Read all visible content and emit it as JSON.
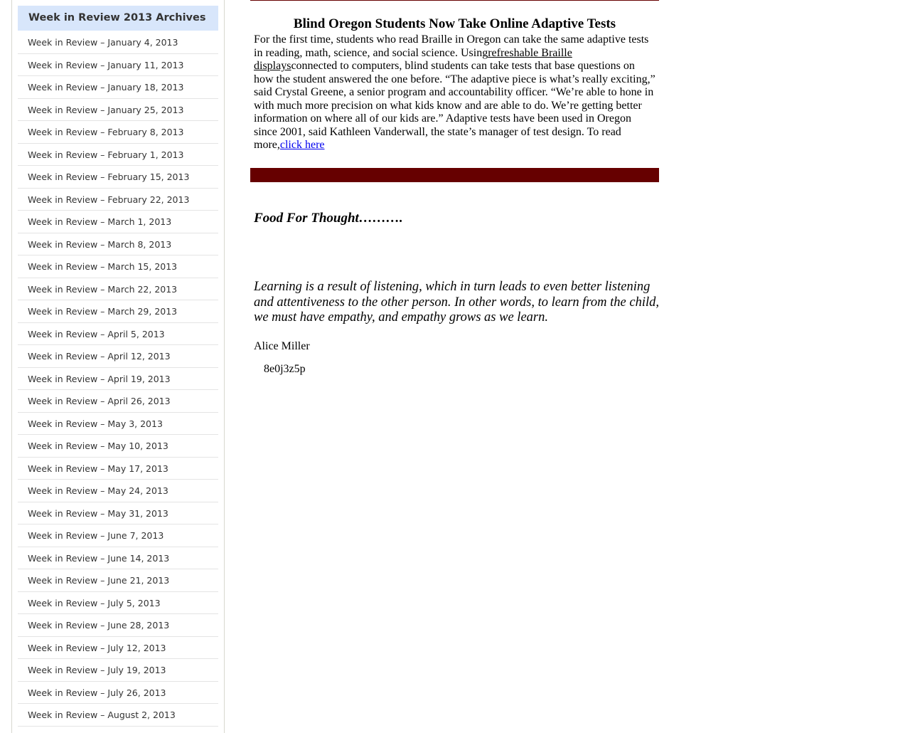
{
  "sidebar": {
    "title": "Week in Review 2013 Archives",
    "items": [
      "Week in Review – January 4, 2013",
      "Week in Review – January 11, 2013",
      "Week in Review – January 18, 2013",
      "Week in Review – January 25, 2013",
      "Week in Review – February 8, 2013",
      "Week in Review – February 1, 2013",
      "Week in Review – February 15, 2013",
      "Week in Review – February 22, 2013",
      "Week in Review – March 1, 2013",
      "Week in Review – March 8, 2013",
      "Week in Review – March 15, 2013",
      "Week in Review – March 22, 2013",
      "Week in Review – March 29, 2013",
      "Week in Review – April 5, 2013",
      "Week in Review – April 12, 2013",
      "Week in Review – April 19, 2013",
      "Week in Review – April 26, 2013",
      "Week in Review – May 3, 2013",
      "Week in Review – May 10, 2013",
      "Week in Review – May 17, 2013",
      "Week in Review – May 24, 2013",
      "Week in Review – May 31, 2013",
      "Week in Review – June 7, 2013",
      "Week in Review – June 14, 2013",
      "Week in Review – June 21, 2013",
      "Week in Review – July 5, 2013",
      "Week in Review – June 28, 2013",
      "Week in Review – July 12, 2013",
      "Week in Review – July 19, 2013",
      "Week in Review – July 26, 2013",
      "Week in Review – August 2, 2013"
    ]
  },
  "article": {
    "title": "Blind Oregon Students Now Take Online Adaptive Tests",
    "text1": "For the first time, students who read Braille in Oregon can take the same adaptive tests in reading, math, science, and social science. Using",
    "link1": "refreshable Braille displays",
    "text2": "connected to computers, blind students can take tests that base questions on how the student answered the one before. “The adaptive piece is what’s really exciting,” said Crystal Greene, a senior program and accountability officer. “We’re able to hone in with much more precision on what kids know and are able to do. We’re getting better information on where all of our kids are.” Adaptive tests have been used in Oregon since 2001, said Kathleen Vanderwall, the state’s manager of test design. To read more,",
    "link2": "click here"
  },
  "food": {
    "heading": "Food For Thought……….",
    "quote": "Learning is a result of listening, which in turn leads to even better listening and attentiveness to the other person. In other words, to learn from the child, we must have empathy, and empathy grows as we learn.",
    "author": "Alice Miller",
    "image_alt": "8e0j3z5p"
  },
  "colors": {
    "accent": "#660000",
    "sidebar_header": "#d8e6fb"
  }
}
